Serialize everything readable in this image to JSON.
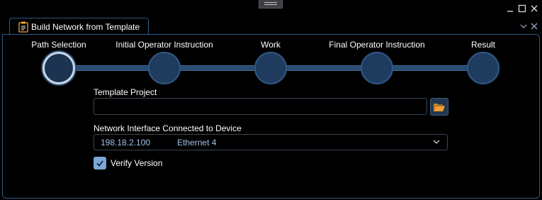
{
  "window": {
    "tab_title": "Build Network from Template",
    "controls": [
      "minimize-icon",
      "maximize-icon",
      "close-icon"
    ],
    "tab_controls": [
      "chevron-down-icon",
      "close-icon"
    ]
  },
  "wizard": {
    "steps": [
      {
        "label": "Path Selection",
        "active": true
      },
      {
        "label": "Initial Operator Instruction",
        "active": false
      },
      {
        "label": "Work",
        "active": false
      },
      {
        "label": "Final Operator Instruction",
        "active": false
      },
      {
        "label": "Result",
        "active": false
      }
    ]
  },
  "form": {
    "template_project": {
      "label": "Template Project",
      "value": ""
    },
    "browse_icon": "folder-open-icon",
    "network_interface": {
      "label": "Network Interface Connected to Device",
      "ip": "198.18.2.100",
      "name": "Ethernet 4"
    },
    "verify_version": {
      "label": "Verify Version",
      "checked": true
    }
  },
  "colors": {
    "accent": "#2b5a86",
    "node_fill": "#1f3b5e",
    "checkbox": "#7aa6d8",
    "folder": "#f0a030"
  }
}
